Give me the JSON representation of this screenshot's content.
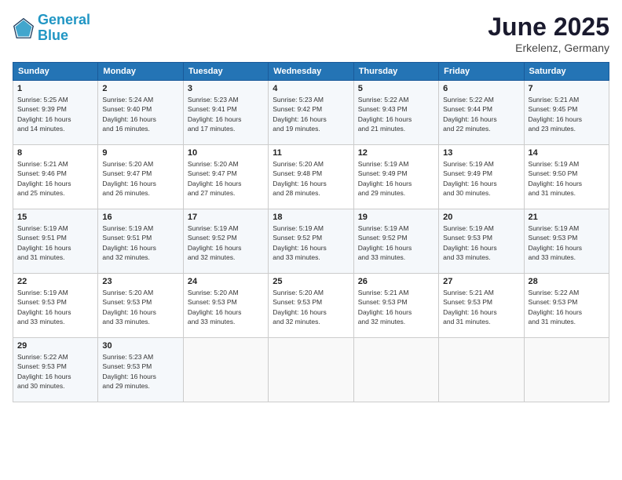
{
  "header": {
    "logo_line1": "General",
    "logo_line2": "Blue",
    "month": "June 2025",
    "location": "Erkelenz, Germany"
  },
  "weekdays": [
    "Sunday",
    "Monday",
    "Tuesday",
    "Wednesday",
    "Thursday",
    "Friday",
    "Saturday"
  ],
  "weeks": [
    [
      {
        "day": "1",
        "info": "Sunrise: 5:25 AM\nSunset: 9:39 PM\nDaylight: 16 hours\nand 14 minutes."
      },
      {
        "day": "2",
        "info": "Sunrise: 5:24 AM\nSunset: 9:40 PM\nDaylight: 16 hours\nand 16 minutes."
      },
      {
        "day": "3",
        "info": "Sunrise: 5:23 AM\nSunset: 9:41 PM\nDaylight: 16 hours\nand 17 minutes."
      },
      {
        "day": "4",
        "info": "Sunrise: 5:23 AM\nSunset: 9:42 PM\nDaylight: 16 hours\nand 19 minutes."
      },
      {
        "day": "5",
        "info": "Sunrise: 5:22 AM\nSunset: 9:43 PM\nDaylight: 16 hours\nand 21 minutes."
      },
      {
        "day": "6",
        "info": "Sunrise: 5:22 AM\nSunset: 9:44 PM\nDaylight: 16 hours\nand 22 minutes."
      },
      {
        "day": "7",
        "info": "Sunrise: 5:21 AM\nSunset: 9:45 PM\nDaylight: 16 hours\nand 23 minutes."
      }
    ],
    [
      {
        "day": "8",
        "info": "Sunrise: 5:21 AM\nSunset: 9:46 PM\nDaylight: 16 hours\nand 25 minutes."
      },
      {
        "day": "9",
        "info": "Sunrise: 5:20 AM\nSunset: 9:47 PM\nDaylight: 16 hours\nand 26 minutes."
      },
      {
        "day": "10",
        "info": "Sunrise: 5:20 AM\nSunset: 9:47 PM\nDaylight: 16 hours\nand 27 minutes."
      },
      {
        "day": "11",
        "info": "Sunrise: 5:20 AM\nSunset: 9:48 PM\nDaylight: 16 hours\nand 28 minutes."
      },
      {
        "day": "12",
        "info": "Sunrise: 5:19 AM\nSunset: 9:49 PM\nDaylight: 16 hours\nand 29 minutes."
      },
      {
        "day": "13",
        "info": "Sunrise: 5:19 AM\nSunset: 9:49 PM\nDaylight: 16 hours\nand 30 minutes."
      },
      {
        "day": "14",
        "info": "Sunrise: 5:19 AM\nSunset: 9:50 PM\nDaylight: 16 hours\nand 31 minutes."
      }
    ],
    [
      {
        "day": "15",
        "info": "Sunrise: 5:19 AM\nSunset: 9:51 PM\nDaylight: 16 hours\nand 31 minutes."
      },
      {
        "day": "16",
        "info": "Sunrise: 5:19 AM\nSunset: 9:51 PM\nDaylight: 16 hours\nand 32 minutes."
      },
      {
        "day": "17",
        "info": "Sunrise: 5:19 AM\nSunset: 9:52 PM\nDaylight: 16 hours\nand 32 minutes."
      },
      {
        "day": "18",
        "info": "Sunrise: 5:19 AM\nSunset: 9:52 PM\nDaylight: 16 hours\nand 33 minutes."
      },
      {
        "day": "19",
        "info": "Sunrise: 5:19 AM\nSunset: 9:52 PM\nDaylight: 16 hours\nand 33 minutes."
      },
      {
        "day": "20",
        "info": "Sunrise: 5:19 AM\nSunset: 9:53 PM\nDaylight: 16 hours\nand 33 minutes."
      },
      {
        "day": "21",
        "info": "Sunrise: 5:19 AM\nSunset: 9:53 PM\nDaylight: 16 hours\nand 33 minutes."
      }
    ],
    [
      {
        "day": "22",
        "info": "Sunrise: 5:19 AM\nSunset: 9:53 PM\nDaylight: 16 hours\nand 33 minutes."
      },
      {
        "day": "23",
        "info": "Sunrise: 5:20 AM\nSunset: 9:53 PM\nDaylight: 16 hours\nand 33 minutes."
      },
      {
        "day": "24",
        "info": "Sunrise: 5:20 AM\nSunset: 9:53 PM\nDaylight: 16 hours\nand 33 minutes."
      },
      {
        "day": "25",
        "info": "Sunrise: 5:20 AM\nSunset: 9:53 PM\nDaylight: 16 hours\nand 32 minutes."
      },
      {
        "day": "26",
        "info": "Sunrise: 5:21 AM\nSunset: 9:53 PM\nDaylight: 16 hours\nand 32 minutes."
      },
      {
        "day": "27",
        "info": "Sunrise: 5:21 AM\nSunset: 9:53 PM\nDaylight: 16 hours\nand 31 minutes."
      },
      {
        "day": "28",
        "info": "Sunrise: 5:22 AM\nSunset: 9:53 PM\nDaylight: 16 hours\nand 31 minutes."
      }
    ],
    [
      {
        "day": "29",
        "info": "Sunrise: 5:22 AM\nSunset: 9:53 PM\nDaylight: 16 hours\nand 30 minutes."
      },
      {
        "day": "30",
        "info": "Sunrise: 5:23 AM\nSunset: 9:53 PM\nDaylight: 16 hours\nand 29 minutes."
      },
      {
        "day": "",
        "info": ""
      },
      {
        "day": "",
        "info": ""
      },
      {
        "day": "",
        "info": ""
      },
      {
        "day": "",
        "info": ""
      },
      {
        "day": "",
        "info": ""
      }
    ]
  ]
}
